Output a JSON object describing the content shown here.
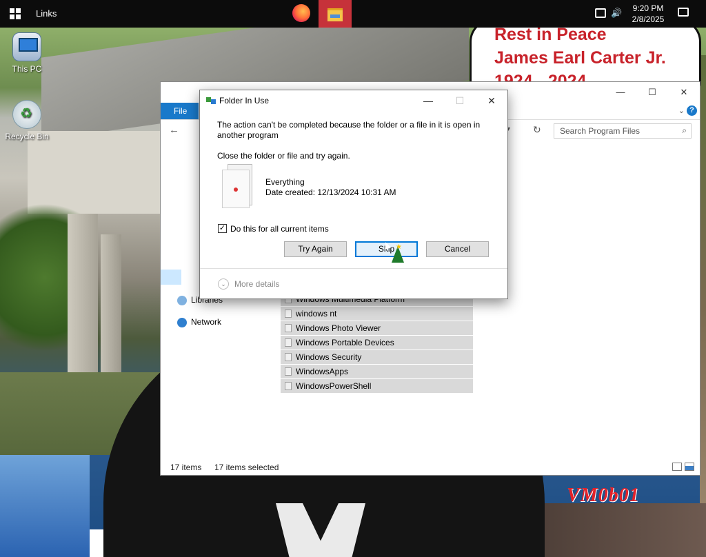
{
  "taskbar": {
    "title": "Links",
    "clock_time": "9:20 PM",
    "clock_date": "2/8/2025"
  },
  "desktop": {
    "icons": [
      {
        "label": "This PC",
        "icon": "computer-icon"
      },
      {
        "label": "Recycle Bin",
        "icon": "recycle-bin-icon"
      }
    ],
    "tribute": {
      "line1": "Rest in Peace",
      "line2": "James Earl Carter Jr.",
      "line3": "1924 - 2024"
    },
    "watermark": "VM0b01"
  },
  "explorer": {
    "file_tab": "File",
    "search_placeholder": "Search Program Files",
    "nav_items": [
      {
        "label": "Libraries",
        "icon": "libraries-icon"
      },
      {
        "label": "Network",
        "icon": "network-icon"
      }
    ],
    "files": [
      "Windows Multimedia Platform",
      "windows nt",
      "Windows Photo Viewer",
      "Windows Portable Devices",
      "Windows Security",
      "WindowsApps",
      "WindowsPowerShell"
    ],
    "status_count": "17 items",
    "status_selected": "17 items selected"
  },
  "dialog": {
    "title": "Folder In Use",
    "message": "The action can't be completed because the folder or a file in it is open in another program",
    "instruction": "Close the folder or file and try again.",
    "file_name": "Everything",
    "file_date": "Date created: 12/13/2024 10:31 AM",
    "checkbox_label": "Do this for all current items",
    "checkbox_checked": true,
    "buttons": {
      "try_again": "Try Again",
      "skip": "Skip",
      "cancel": "Cancel"
    },
    "more_details": "More details"
  }
}
